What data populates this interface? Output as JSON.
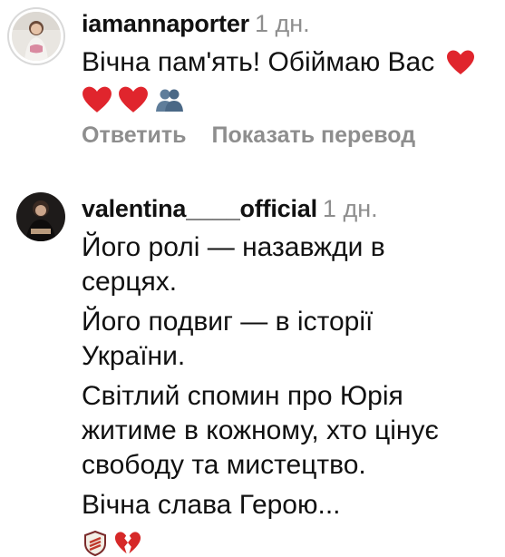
{
  "comments": [
    {
      "username": "iamannaporter",
      "time": "1 дн.",
      "text_line1": "Вічна пам'ять! Обіймаю Вас",
      "emoji": [
        "red-heart",
        "red-heart",
        "red-heart",
        "people-silhouette"
      ],
      "actions": {
        "reply": "Ответить",
        "translate": "Показать перевод"
      }
    },
    {
      "username": "valentina____official",
      "time": "1 дн.",
      "paragraphs": [
        "Його ролі — назавжди в серцях.",
        "Його подвиг — в історії України.",
        "Світлий спомин про Юрія житиме в кожному, хто цінує свободу та мистецтво.",
        "Вічна слава Герою..."
      ],
      "emoji": [
        "shield",
        "broken-heart"
      ]
    }
  ],
  "colors": {
    "muted": "#8e8e8e",
    "heart": "#e0252d",
    "text": "#111111"
  }
}
